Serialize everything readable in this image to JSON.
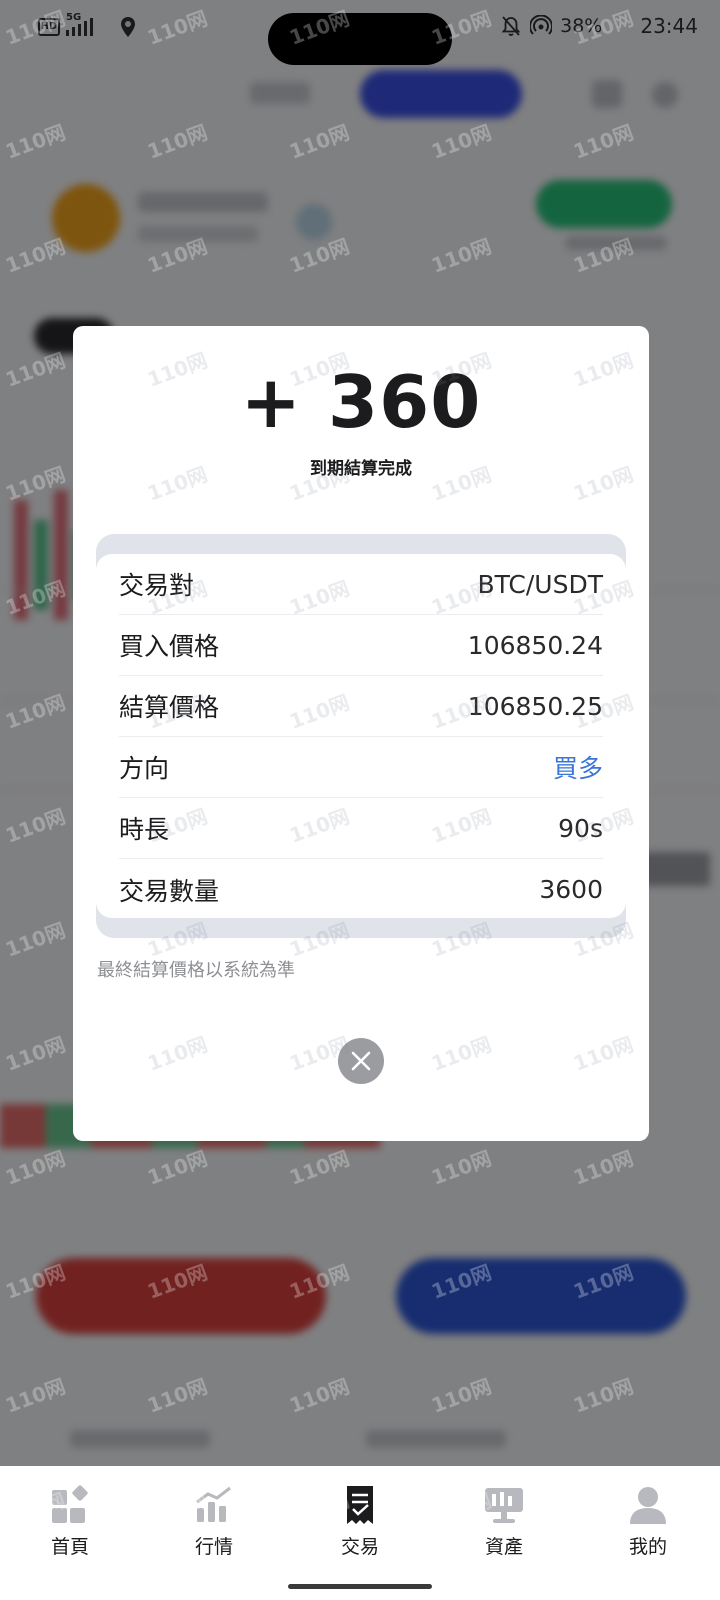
{
  "status_bar": {
    "network_badge": "HD",
    "network_type": "5G",
    "battery": "38%",
    "time": "23:44"
  },
  "result_dialog": {
    "amount": "+ 360",
    "subtitle": "到期結算完成",
    "details": [
      {
        "label": "交易對",
        "value": "BTC/USDT"
      },
      {
        "label": "買入價格",
        "value": "106850.24"
      },
      {
        "label": "結算價格",
        "value": "106850.25"
      },
      {
        "label": "方向",
        "value": "買多"
      },
      {
        "label": "時長",
        "value": "90s"
      },
      {
        "label": "交易數量",
        "value": "3600"
      }
    ],
    "note": "最終結算價格以系統為準",
    "direction_color": "#3a76d8"
  },
  "bottom_nav": {
    "items": [
      {
        "label": "首頁",
        "icon": "home-icon"
      },
      {
        "label": "行情",
        "icon": "market-chart-icon"
      },
      {
        "label": "交易",
        "icon": "trade-receipt-icon",
        "active": true
      },
      {
        "label": "資產",
        "icon": "assets-icon"
      },
      {
        "label": "我的",
        "icon": "profile-icon"
      }
    ]
  },
  "watermark": "110网"
}
